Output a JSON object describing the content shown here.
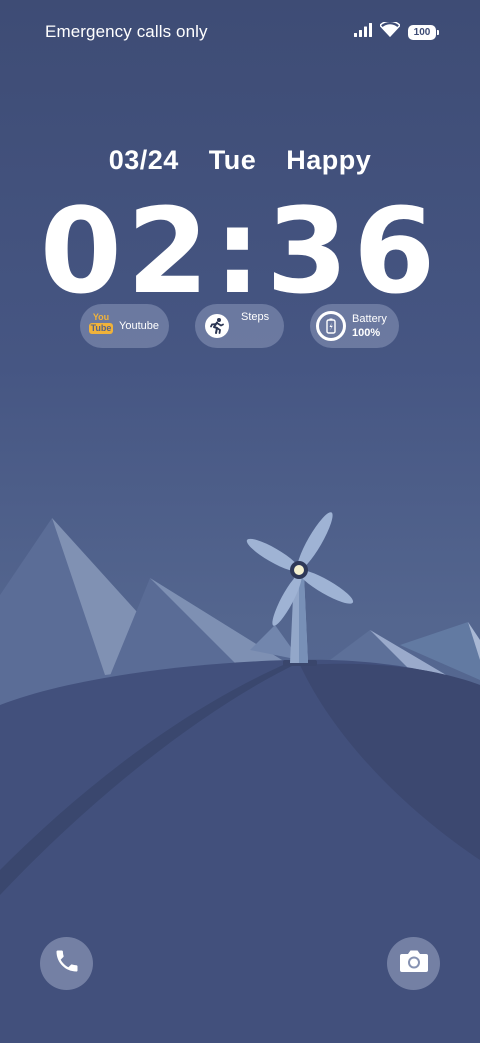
{
  "status_bar": {
    "carrier_text": "Emergency calls only",
    "battery_level": "100",
    "icons": [
      "signal-icon",
      "wifi-icon",
      "battery-icon"
    ]
  },
  "date": {
    "date": "03/24",
    "weekday": "Tue",
    "greeting": "Happy"
  },
  "clock": {
    "time": "02:36"
  },
  "widgets": {
    "youtube": {
      "logo_top": "You",
      "logo_bottom": "Tube",
      "label": "Youtube"
    },
    "steps": {
      "label": "Steps"
    },
    "battery": {
      "label": "Battery",
      "value": "100%"
    }
  },
  "dock": {
    "left": "phone-icon",
    "right": "camera-icon"
  },
  "colors": {
    "background_top": "#3e4c75",
    "background_bottom": "#5a6d96",
    "youtube_accent": "#f0b23a"
  }
}
